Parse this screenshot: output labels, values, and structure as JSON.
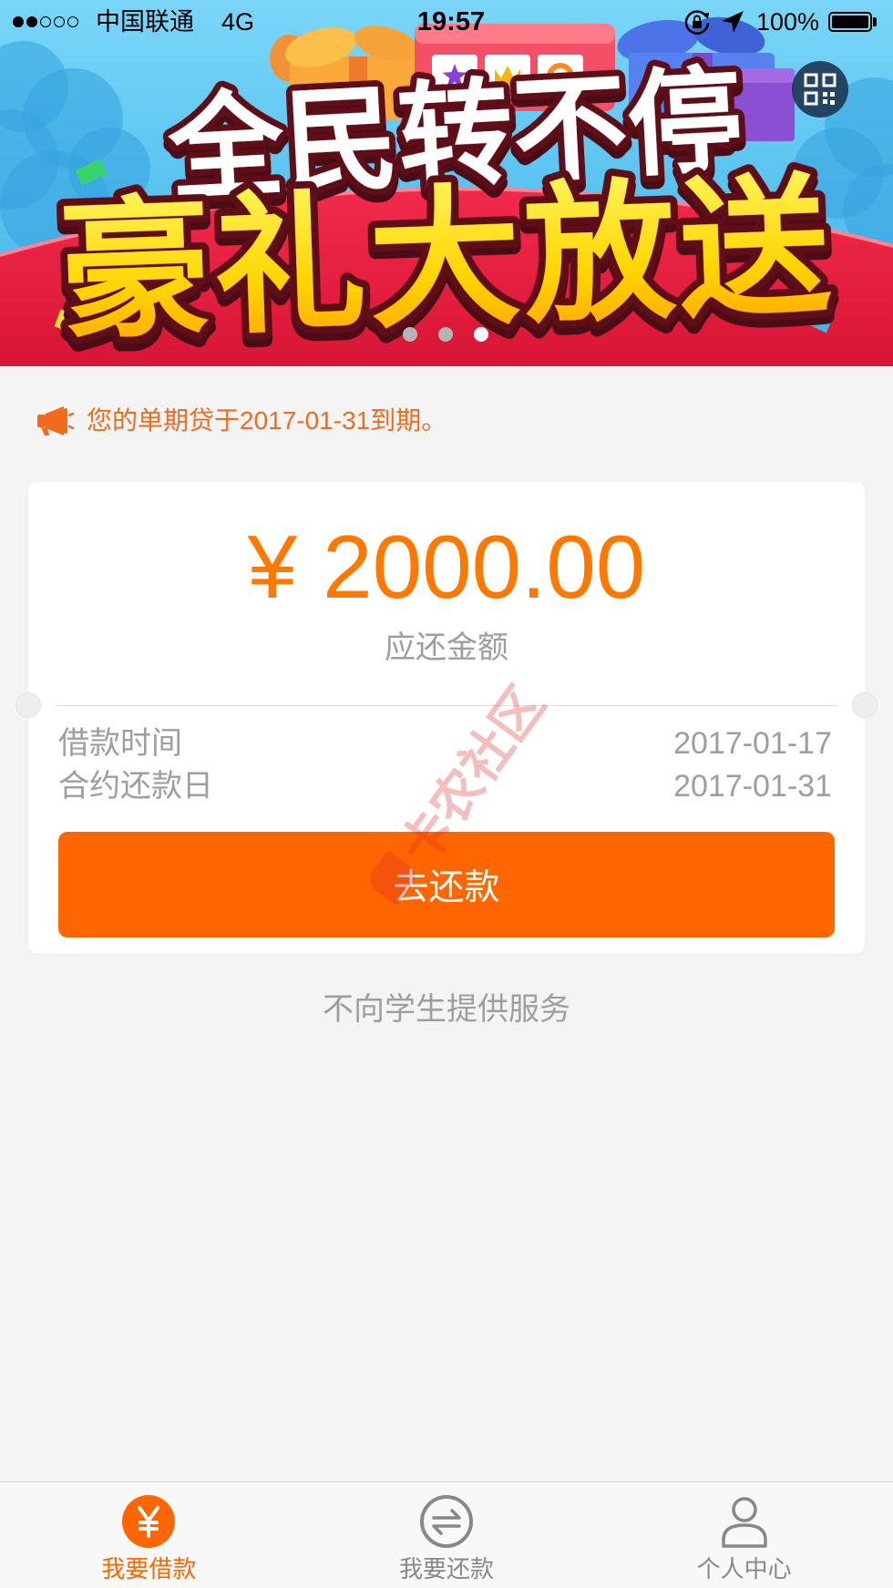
{
  "status_bar": {
    "signal_strength": 2,
    "signal_max": 5,
    "carrier": "中国联通",
    "network": "4G",
    "time": "19:57",
    "battery_text": "100%",
    "battery_level": 1.0,
    "icons": {
      "rotation_lock": "rotation-lock-icon",
      "location": "location-arrow-icon",
      "battery": "battery-icon"
    }
  },
  "banner": {
    "headline": "全民转不停",
    "subheadline": "豪礼大放送",
    "page_count": 3,
    "active_page": 3,
    "qr_icon": "qr-code-icon"
  },
  "notice": {
    "icon": "megaphone-icon",
    "text": "您的单期贷于2017-01-31到期。"
  },
  "repayment_card": {
    "currency_symbol": "¥",
    "amount": "2000.00",
    "amount_label": "应还金额",
    "rows": [
      {
        "label": "借款时间",
        "value": "2017-01-17"
      },
      {
        "label": "合约还款日",
        "value": "2017-01-31"
      }
    ],
    "action_label": "去还款"
  },
  "watermark": "卡农社区",
  "footer_note": "不向学生提供服务",
  "tab_bar": {
    "tabs": [
      {
        "label": "我要借款",
        "icon": "yuan-icon",
        "active": true
      },
      {
        "label": "我要还款",
        "icon": "exchange-icon",
        "active": false
      },
      {
        "label": "个人中心",
        "icon": "person-icon",
        "active": false
      }
    ]
  },
  "colors": {
    "accent": "#ff6600",
    "amount": "#ff7800",
    "notice": "#f26a1e",
    "secondary_text": "#9e9e9e",
    "inactive_tab": "#888888",
    "background": "#f4f4f4"
  }
}
